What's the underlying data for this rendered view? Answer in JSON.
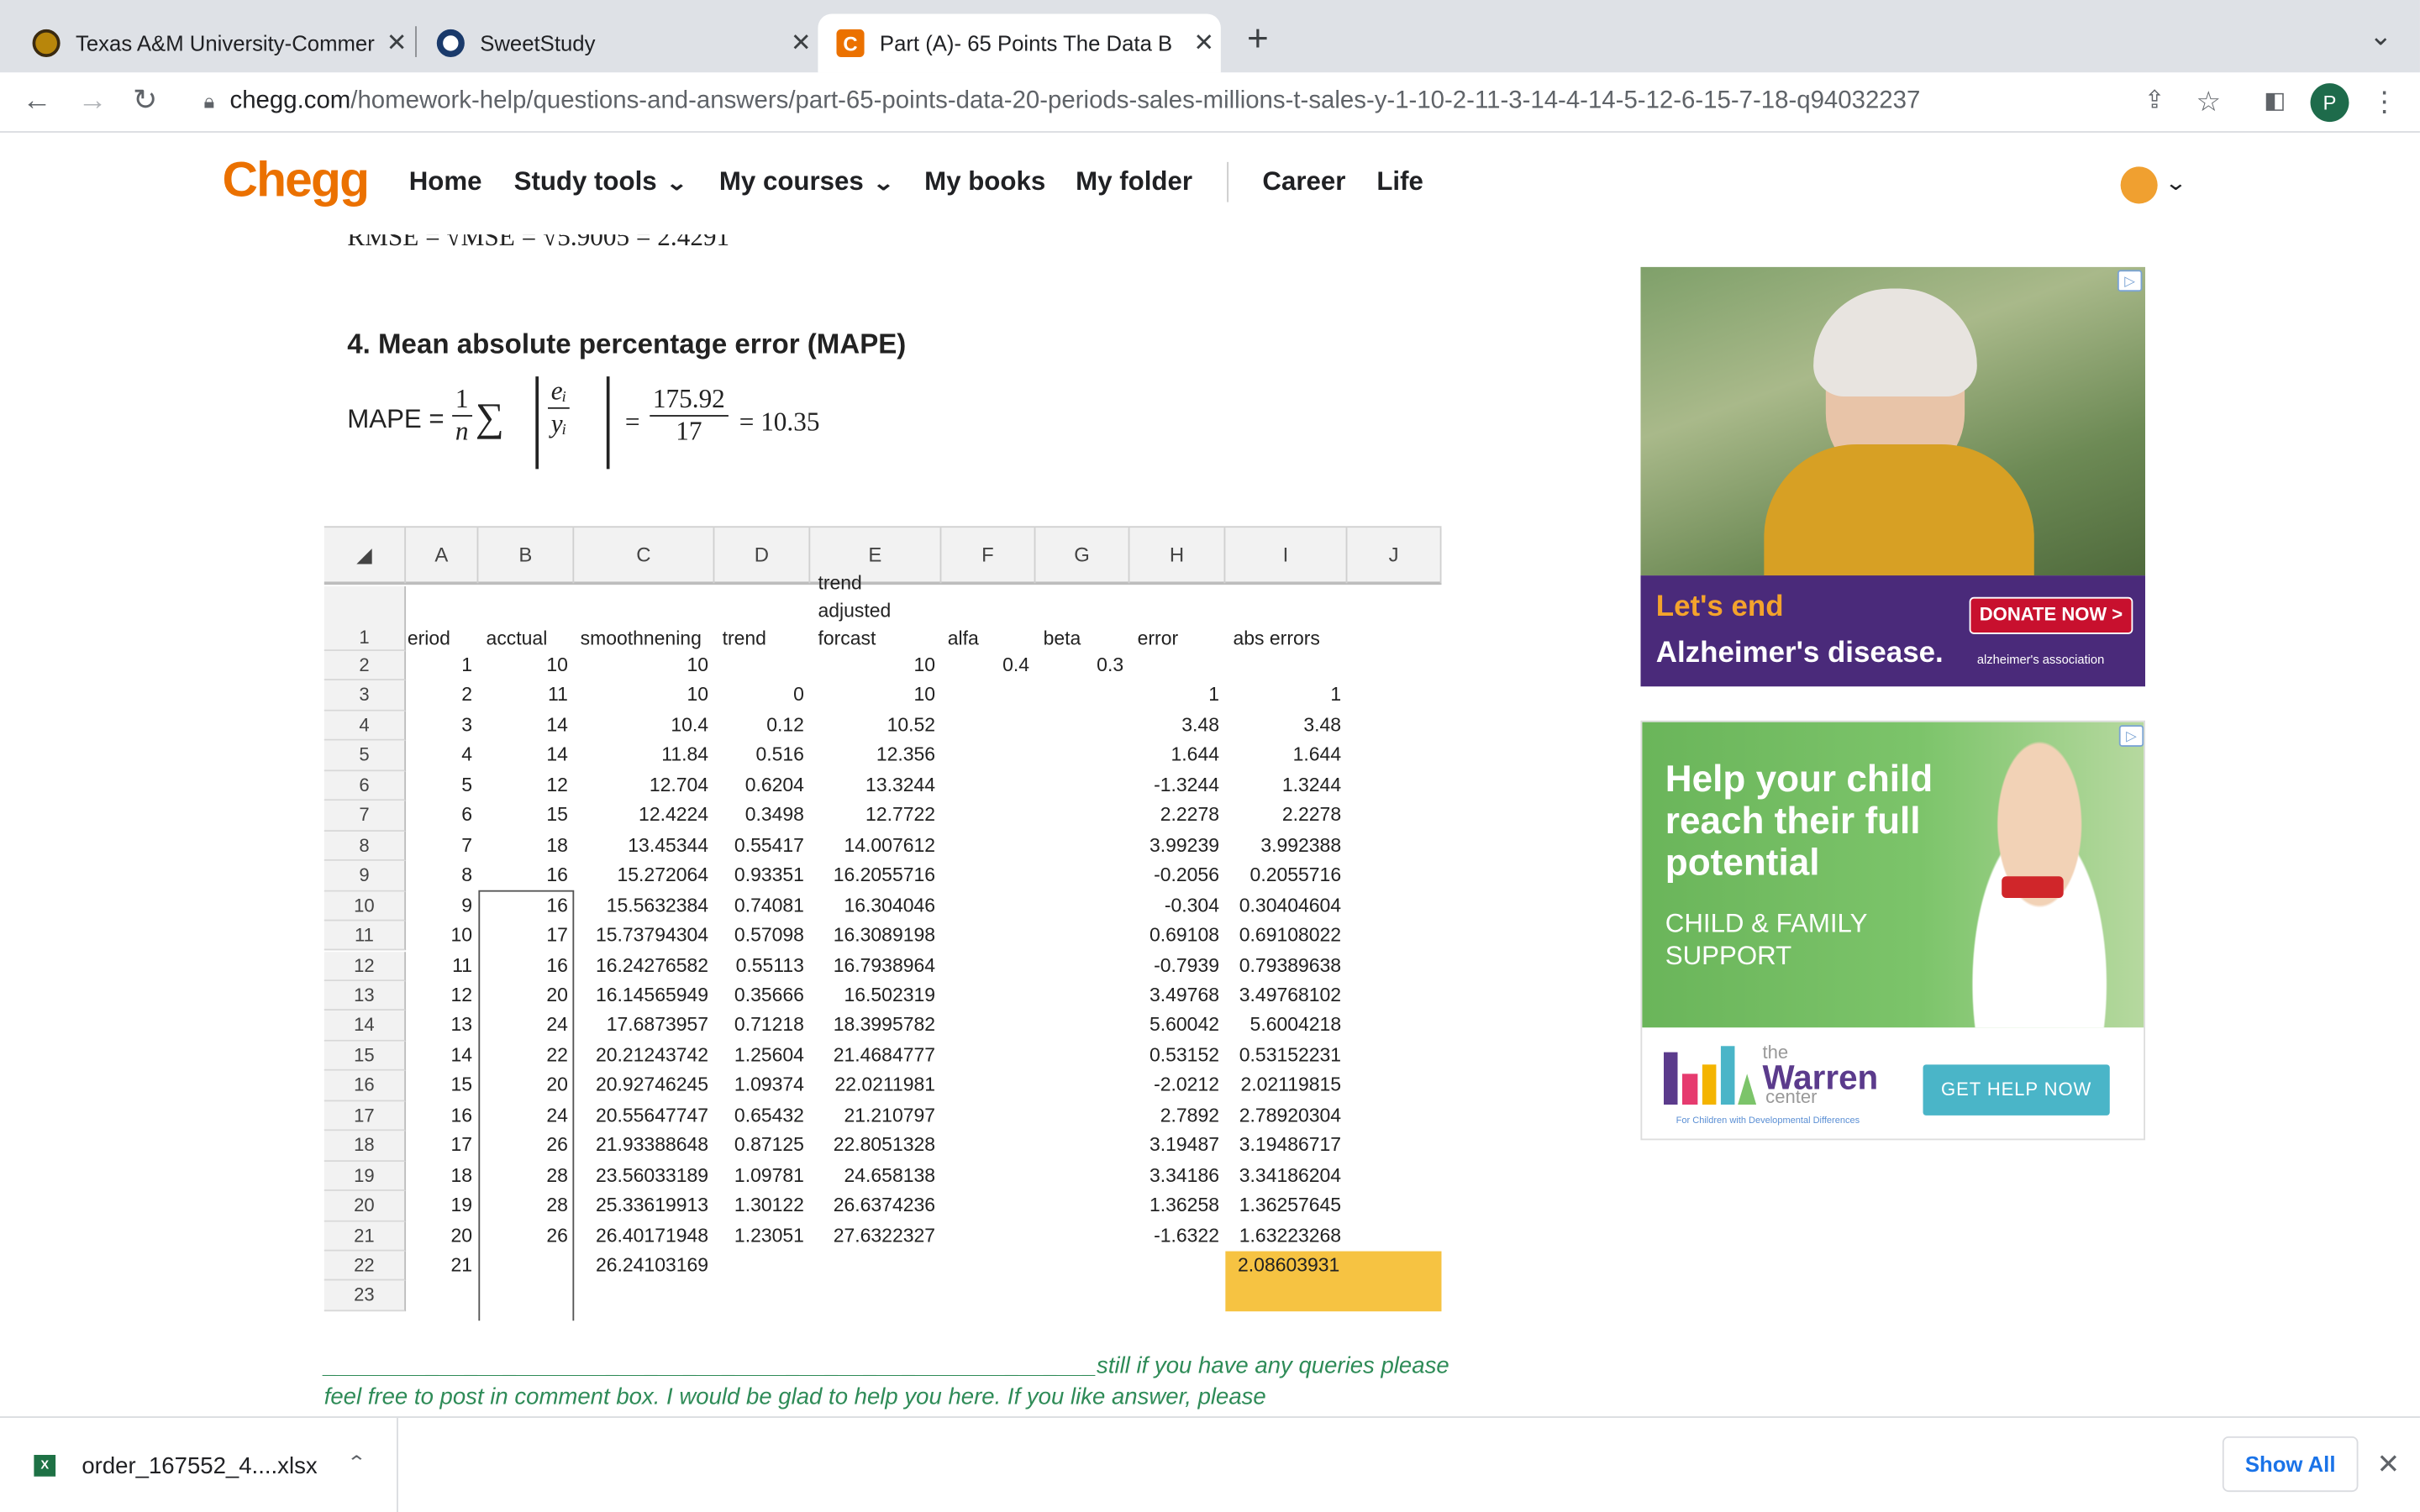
{
  "browser": {
    "tabs": [
      {
        "title": "Texas A&M University-Commer",
        "close": "✕",
        "favicon": "tamuc-icon"
      },
      {
        "title": "SweetStudy",
        "close": "✕",
        "favicon": "sweetstudy-icon"
      },
      {
        "title": "Part (A)- 65 Points The Data B",
        "close": "✕",
        "favicon": "chegg-c-icon"
      }
    ],
    "new_tab": "+",
    "url_domain": "chegg.com",
    "url_path": "/homework-help/questions-and-answers/part-65-points-data-20-periods-sales-millions-t-sales-y-1-10-2-11-3-14-4-14-5-12-6-15-7-18-q94032237",
    "profile_initial": "P"
  },
  "chegg_nav": {
    "logo": "Chegg",
    "items": [
      "Home",
      "Study tools",
      "My courses",
      "My books",
      "My folder",
      "Career",
      "Life"
    ]
  },
  "answer": {
    "rmse_line": "RMSE = √MSE = √5.9005 = 2.4291",
    "mape_heading": "4. Mean absolute percentage error (MAPE)",
    "mape_label": "MAPE =",
    "mape_frac1_num": "1",
    "mape_frac1_den": "n",
    "mape_sigma": "∑",
    "mape_inner_num": "eᵢ",
    "mape_inner_den": "yᵢ",
    "mape_eq": "=",
    "mape_frac2_num": "175.92",
    "mape_frac2_den": "17",
    "mape_result": "= 10.35",
    "comment": "____________________________________________________________still if you have any queries please feel free to post in comment box. I would be glad to help you here. If you like answer, please"
  },
  "spreadsheet": {
    "corner": "◢",
    "columns": [
      "A",
      "B",
      "C",
      "D",
      "E",
      "F",
      "G",
      "H",
      "I",
      "J"
    ],
    "header_row": {
      "num": "1",
      "A": "eriod",
      "B": "acctual",
      "C": "smoothnening",
      "D": "trend",
      "E_top": "trend",
      "E_mid": "adjusted",
      "E_bot": "forcast",
      "F": "alfa",
      "G": "beta",
      "H": "error",
      "I": "abs errors"
    },
    "rows": [
      {
        "num": "2",
        "A": "1",
        "B": "10",
        "C": "10",
        "D": "",
        "E": "10",
        "F": "0.4",
        "G": "0.3",
        "H": "",
        "I": ""
      },
      {
        "num": "3",
        "A": "2",
        "B": "11",
        "C": "10",
        "D": "0",
        "E": "10",
        "F": "",
        "G": "",
        "H": "1",
        "I": "1"
      },
      {
        "num": "4",
        "A": "3",
        "B": "14",
        "C": "10.4",
        "D": "0.12",
        "E": "10.52",
        "F": "",
        "G": "",
        "H": "3.48",
        "I": "3.48"
      },
      {
        "num": "5",
        "A": "4",
        "B": "14",
        "C": "11.84",
        "D": "0.516",
        "E": "12.356",
        "F": "",
        "G": "",
        "H": "1.644",
        "I": "1.644"
      },
      {
        "num": "6",
        "A": "5",
        "B": "12",
        "C": "12.704",
        "D": "0.6204",
        "E": "13.3244",
        "F": "",
        "G": "",
        "H": "-1.3244",
        "I": "1.3244"
      },
      {
        "num": "7",
        "A": "6",
        "B": "15",
        "C": "12.4224",
        "D": "0.3498",
        "E": "12.7722",
        "F": "",
        "G": "",
        "H": "2.2278",
        "I": "2.2278"
      },
      {
        "num": "8",
        "A": "7",
        "B": "18",
        "C": "13.45344",
        "D": "0.55417",
        "E": "14.007612",
        "F": "",
        "G": "",
        "H": "3.99239",
        "I": "3.992388"
      },
      {
        "num": "9",
        "A": "8",
        "B": "16",
        "C": "15.272064",
        "D": "0.93351",
        "E": "16.2055716",
        "F": "",
        "G": "",
        "H": "-0.2056",
        "I": "0.2055716"
      },
      {
        "num": "10",
        "A": "9",
        "B": "16",
        "C": "15.5632384",
        "D": "0.74081",
        "E": "16.304046",
        "F": "",
        "G": "",
        "H": "-0.304",
        "I": "0.30404604"
      },
      {
        "num": "11",
        "A": "10",
        "B": "17",
        "C": "15.73794304",
        "D": "0.57098",
        "E": "16.3089198",
        "F": "",
        "G": "",
        "H": "0.69108",
        "I": "0.69108022"
      },
      {
        "num": "12",
        "A": "11",
        "B": "16",
        "C": "16.24276582",
        "D": "0.55113",
        "E": "16.7938964",
        "F": "",
        "G": "",
        "H": "-0.7939",
        "I": "0.79389638"
      },
      {
        "num": "13",
        "A": "12",
        "B": "20",
        "C": "16.14565949",
        "D": "0.35666",
        "E": "16.502319",
        "F": "",
        "G": "",
        "H": "3.49768",
        "I": "3.49768102"
      },
      {
        "num": "14",
        "A": "13",
        "B": "24",
        "C": "17.6873957",
        "D": "0.71218",
        "E": "18.3995782",
        "F": "",
        "G": "",
        "H": "5.60042",
        "I": "5.6004218"
      },
      {
        "num": "15",
        "A": "14",
        "B": "22",
        "C": "20.21243742",
        "D": "1.25604",
        "E": "21.4684777",
        "F": "",
        "G": "",
        "H": "0.53152",
        "I": "0.53152231"
      },
      {
        "num": "16",
        "A": "15",
        "B": "20",
        "C": "20.92746245",
        "D": "1.09374",
        "E": "22.0211981",
        "F": "",
        "G": "",
        "H": "-2.0212",
        "I": "2.02119815"
      },
      {
        "num": "17",
        "A": "16",
        "B": "24",
        "C": "20.55647747",
        "D": "0.65432",
        "E": "21.210797",
        "F": "",
        "G": "",
        "H": "2.7892",
        "I": "2.78920304"
      },
      {
        "num": "18",
        "A": "17",
        "B": "26",
        "C": "21.93388648",
        "D": "0.87125",
        "E": "22.8051328",
        "F": "",
        "G": "",
        "H": "3.19487",
        "I": "3.19486717"
      },
      {
        "num": "19",
        "A": "18",
        "B": "28",
        "C": "23.56033189",
        "D": "1.09781",
        "E": "24.658138",
        "F": "",
        "G": "",
        "H": "3.34186",
        "I": "3.34186204"
      },
      {
        "num": "20",
        "A": "19",
        "B": "28",
        "C": "25.33619913",
        "D": "1.30122",
        "E": "26.6374236",
        "F": "",
        "G": "",
        "H": "1.36258",
        "I": "1.36257645"
      },
      {
        "num": "21",
        "A": "20",
        "B": "26",
        "C": "26.40171948",
        "D": "1.23051",
        "E": "27.6322327",
        "F": "",
        "G": "",
        "H": "-1.6322",
        "I": "1.63223268"
      },
      {
        "num": "22",
        "A": "21",
        "B": "",
        "C": "26.24103169",
        "D": "",
        "E": "",
        "F": "",
        "G": "",
        "H": "",
        "I": "2.08603931"
      },
      {
        "num": "23",
        "A": "",
        "B": "",
        "C": "",
        "D": "",
        "E": "",
        "F": "",
        "G": "",
        "H": "",
        "I": ""
      }
    ],
    "highlight_color": "#f6c342"
  },
  "ads": {
    "ad1": {
      "line1": "Let's end",
      "line2": "Alzheimer's disease.",
      "button": "DONATE NOW >",
      "org": "alzheimer's association",
      "badge": "▷"
    },
    "ad2": {
      "headline": "Help your child reach their full potential",
      "sub": "CHILD & FAMILY SUPPORT",
      "the": "the",
      "name": "Warren",
      "center": "center",
      "tagline": "For Children with Developmental Differences",
      "button": "GET HELP NOW",
      "badge": "▷"
    }
  },
  "downloads": {
    "file": "order_167552_4....xlsx",
    "file_icon": "X",
    "show_all": "Show All",
    "close": "✕"
  },
  "colors": {
    "chegg_orange": "#eb7100",
    "link_blue": "#1a73e8",
    "comment_green": "#2e8b57"
  }
}
